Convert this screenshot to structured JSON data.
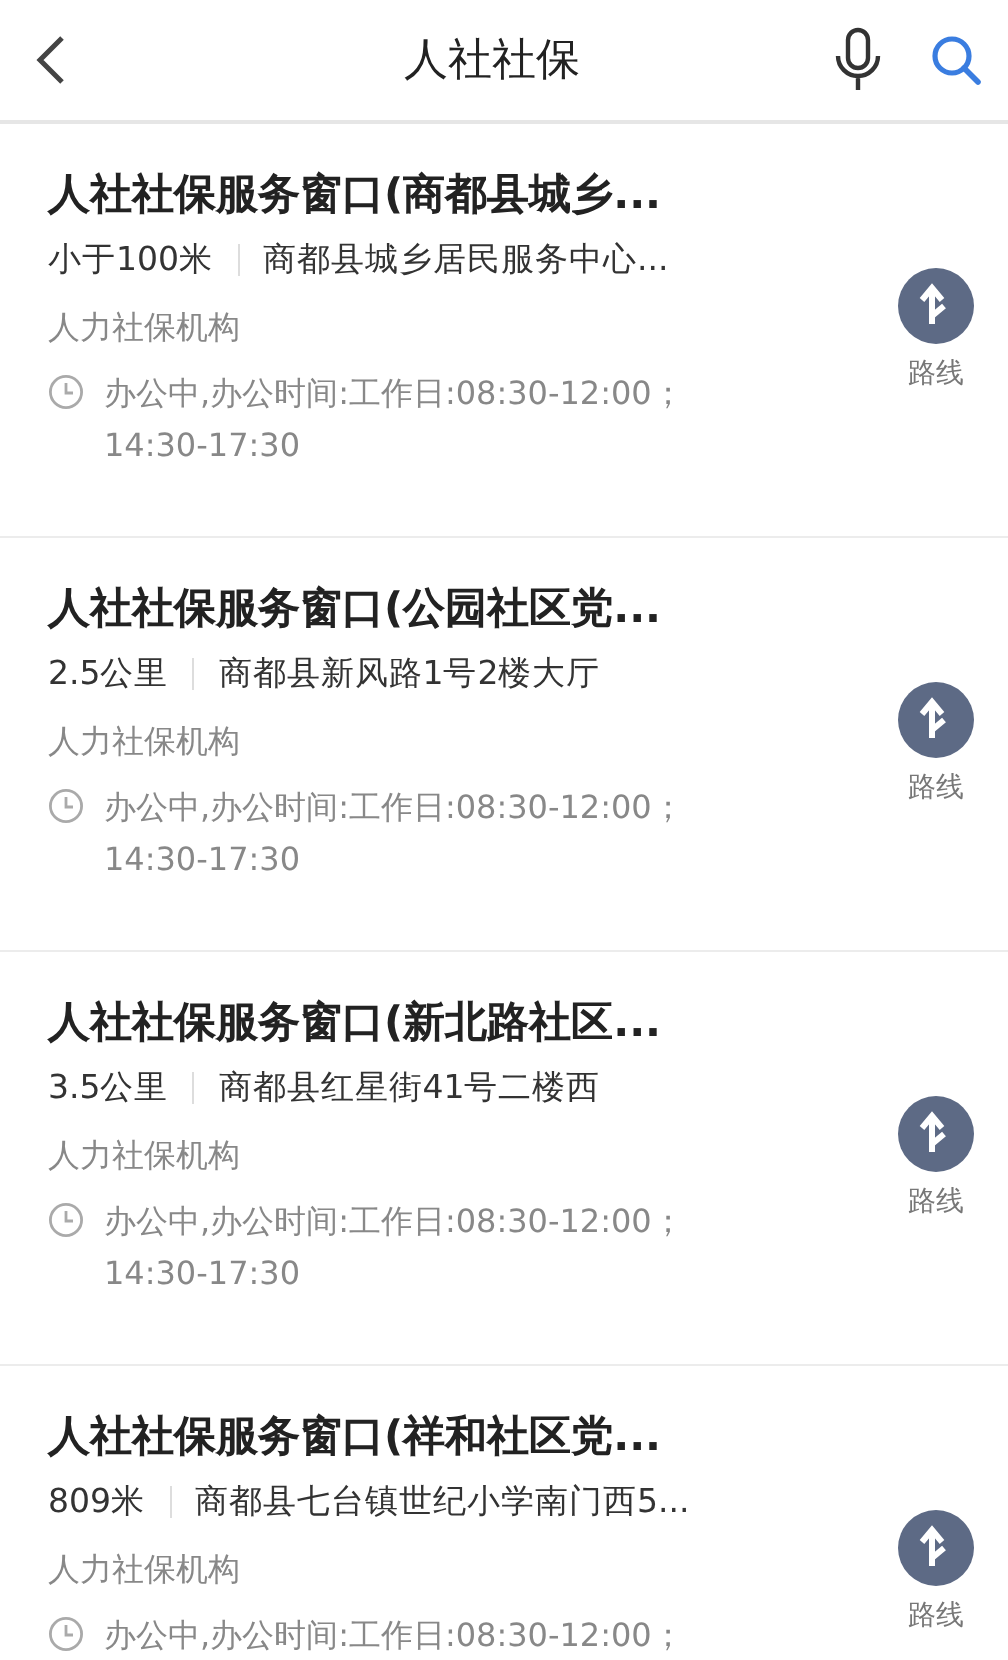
{
  "header": {
    "title": "人社社保"
  },
  "results": [
    {
      "name": "人社社保服务窗口(商都县城乡...",
      "distance": "小于100米",
      "address": "商都县城乡居民服务中心...",
      "category": "人力社保机构",
      "hours": [
        "办公中,办公时间:工作日:08:30-12:00；",
        "14:30-17:30"
      ],
      "route": "路线"
    },
    {
      "name": "人社社保服务窗口(公园社区党...",
      "distance": "2.5公里",
      "address": "商都县新风路1号2楼大厅",
      "category": "人力社保机构",
      "hours": [
        "办公中,办公时间:工作日:08:30-12:00；",
        "14:30-17:30"
      ],
      "route": "路线"
    },
    {
      "name": "人社社保服务窗口(新北路社区...",
      "distance": "3.5公里",
      "address": "商都县红星街41号二楼西",
      "category": "人力社保机构",
      "hours": [
        "办公中,办公时间:工作日:08:30-12:00；",
        "14:30-17:30"
      ],
      "route": "路线"
    },
    {
      "name": "人社社保服务窗口(祥和社区党...",
      "distance": "809米",
      "address": "商都县七台镇世纪小学南门西5...",
      "category": "人力社保机构",
      "hours": [
        "办公中,办公时间:工作日:08:30-12:00；"
      ],
      "route": "路线"
    }
  ]
}
